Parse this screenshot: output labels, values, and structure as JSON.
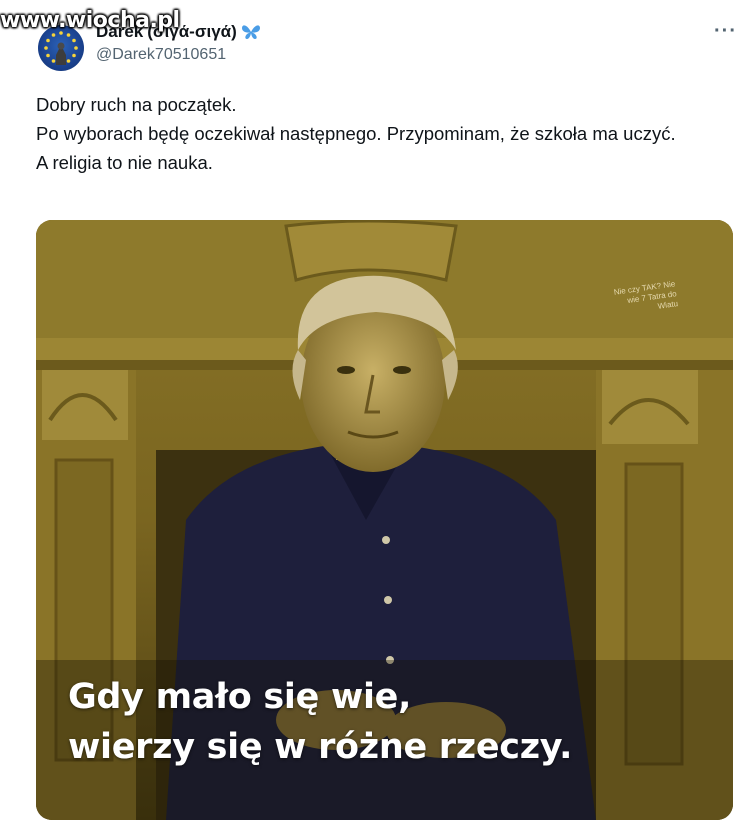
{
  "watermark": "www.wiocha.pl",
  "author": {
    "display_name": "Darek",
    "display_name_suffix": "(σιγά-σιγά)",
    "handle": "@Darek70510651",
    "emoji_icon": "butterfly-icon",
    "avatar_icon": "eu-flag-avatar"
  },
  "more_label": "···",
  "tweet": {
    "lines": [
      "Dobry ruch na początek.",
      "Po wyborach będę oczekiwał następnego. Przypominam, że szkoła ma uczyć.",
      "A religia to nie nauka."
    ]
  },
  "media": {
    "caption_line1": "Gdy mało się wie,",
    "caption_line2": "wierzy się w różne rzeczy.",
    "corner_mark": "Nie czy TAK? Nie wie 7 Tatra do Wiatu",
    "colors": {
      "tint": "#6b5a1a",
      "shirt": "#1c1d3a"
    }
  }
}
